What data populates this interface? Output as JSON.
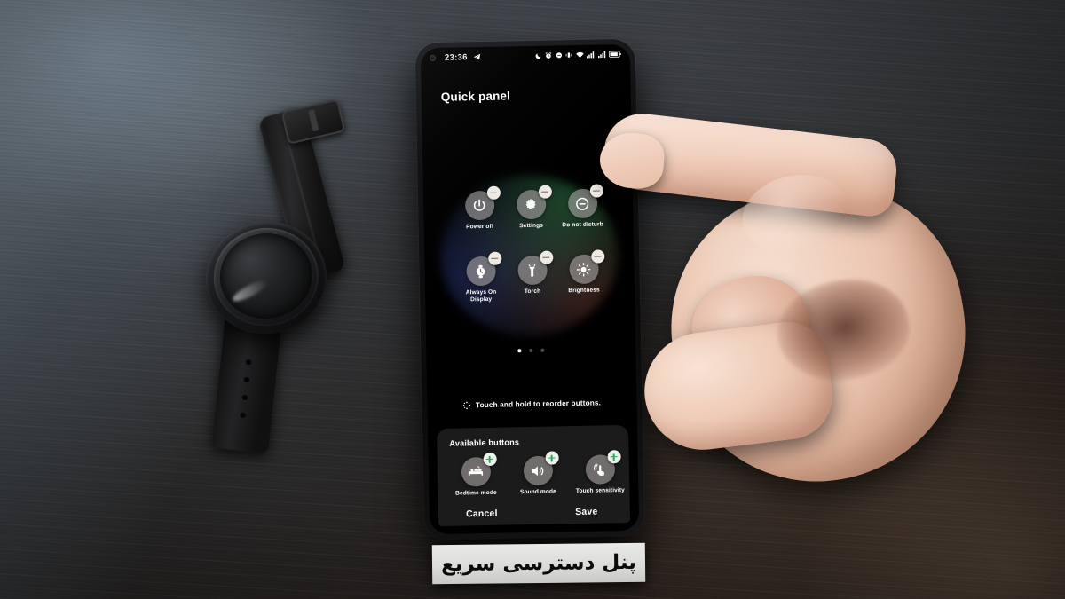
{
  "phone": {
    "status_bar": {
      "time": "23:36",
      "left_icons": [
        "camera-punch-hole",
        "telegram-icon"
      ],
      "right_icons": [
        "moon-icon",
        "alarm-icon",
        "do-not-disturb-icon",
        "vibrate-icon",
        "wifi-icon",
        "signal-icon",
        "signal-icon",
        "battery-icon"
      ]
    },
    "page_title": "Quick panel",
    "active_tiles": [
      {
        "label": "Power off",
        "icon": "power-icon",
        "badge": "remove"
      },
      {
        "label": "Settings",
        "icon": "gear-icon",
        "badge": "remove"
      },
      {
        "label": "Do not disturb",
        "icon": "dnd-icon",
        "badge": "remove"
      },
      {
        "label": "Always On Display",
        "icon": "watch-clock-icon",
        "badge": "remove"
      },
      {
        "label": "Torch",
        "icon": "flashlight-icon",
        "badge": "remove"
      },
      {
        "label": "Brightness",
        "icon": "sun-icon",
        "badge": "remove"
      }
    ],
    "pager": {
      "count": 3,
      "active": 1
    },
    "hint": {
      "icon": "reorder-icon",
      "text": "Touch and hold to reorder buttons."
    },
    "available": {
      "heading": "Available buttons",
      "items": [
        {
          "label": "Bedtime mode",
          "icon": "bed-icon",
          "badge": "add"
        },
        {
          "label": "Sound mode",
          "icon": "speaker-icon",
          "badge": "add"
        },
        {
          "label": "Touch sensitivity",
          "icon": "touch-sensor-icon",
          "badge": "add"
        }
      ]
    },
    "actions": {
      "cancel": "Cancel",
      "save": "Save"
    }
  },
  "caption": {
    "text": "پنل دسترسی سریع"
  },
  "objects": {
    "watch": "black-smartwatch",
    "hand": "pointing-hand"
  },
  "colors": {
    "accent_green": "#2da35c",
    "tile_fill": "#b0a8a8",
    "panel_bg": "#1b1b1c",
    "screen_bg": "#000000",
    "text": "#ffffff",
    "caption_bg": "#dcdcda"
  }
}
